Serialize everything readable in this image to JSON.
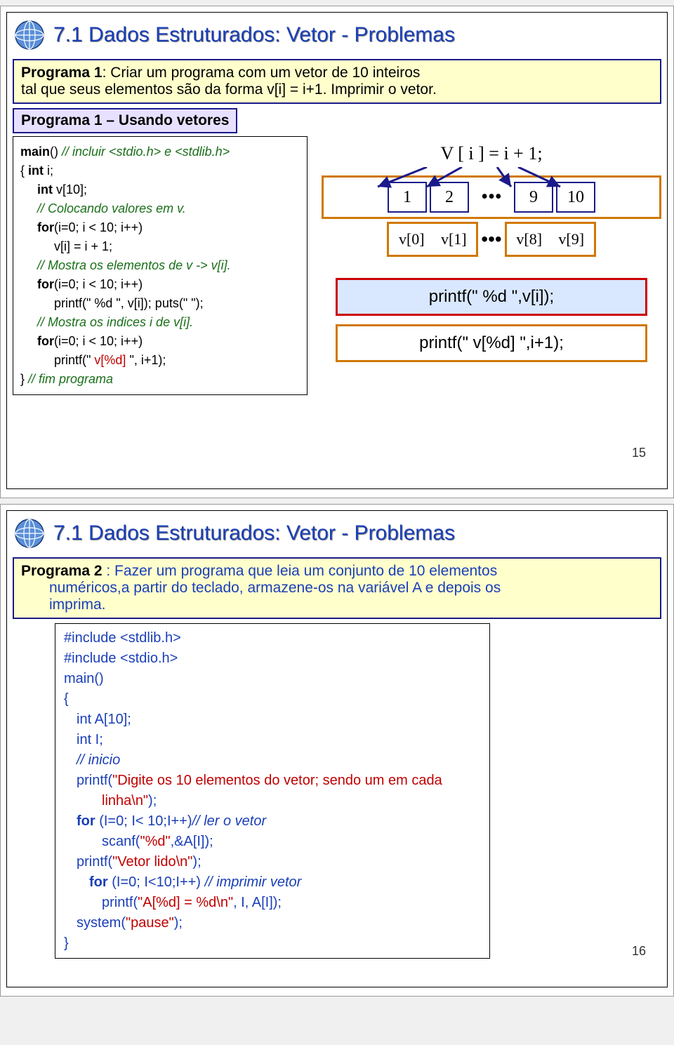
{
  "slide1": {
    "title": "7.1 Dados Estruturados: Vetor - Problemas",
    "problem": {
      "label": "Programa 1",
      "text_a": ": Criar um programa com um vetor de 10 inteiros",
      "text_b": "tal que seus elementos são da forma v[i] = i+1. Imprimir o vetor."
    },
    "purple_label": "Programa 1 – Usando vetores",
    "code": {
      "l1_a": "main",
      "l1_b": "() ",
      "l1_c": "// incluir <stdio.h> e <stdlib.h>",
      "l2_a": "{ ",
      "l2_b": "int",
      "l2_c": " i;",
      "l3_a": "int",
      "l3_b": " v[10];",
      "l4": "// Colocando valores em v.",
      "l5_a": "for",
      "l5_b": "(i=0; i < 10; i++)",
      "l6": "v[i] = i + 1;",
      "l7": "// Mostra os elementos de v -> v[i].",
      "l8_a": "for",
      "l8_b": "(i=0; i < 10; i++)",
      "l9": "printf(\" %d \", v[i]); puts(\" \");",
      "l10": "// Mostra os indices i de v[i].",
      "l11_a": "for",
      "l11_b": "(i=0; i < 10; i++)",
      "l12_a": "printf(\" ",
      "l12_b": "v[%d]",
      "l12_c": " \", i+1);",
      "l13_a": "} ",
      "l13_b": "// fim programa"
    },
    "diagram": {
      "formula": "V [ i ] = i + 1;",
      "vals": [
        "1",
        "2",
        "•••",
        "9",
        "10"
      ],
      "idx": [
        "v[0]",
        "v[1]",
        "•••",
        "v[8]",
        "v[9]"
      ],
      "printf1": "printf(\" %d \",v[i]);",
      "printf2": "printf(\" v[%d] \",i+1);"
    },
    "page": "15"
  },
  "slide2": {
    "title": "7.1 Dados Estruturados: Vetor - Problemas",
    "problem": {
      "label": "Programa 2 ",
      "text_a": ": Fazer um programa que leia um conjunto de 10 elementos",
      "text_b": "numéricos,a partir do teclado, ",
      "text_c": " armazene-os na variável A e depois os",
      "text_d": "imprima."
    },
    "code": {
      "inc1": "#include <stdlib.h>",
      "inc2": "#include <stdio.h>",
      "main": "main()",
      "ob": "{",
      "d1": "int  A[10];",
      "d2": "int  I;",
      "cm1": "// inicio",
      "p1_a": "printf(",
      "p1_b": "\"Digite os 10 elementos do vetor; sendo um em cada ",
      "p1_c": "linha\\n\"",
      "p1_d": ");",
      "for1_a": "for ",
      "for1_b": "(I=0; I< 10;I++)",
      "for1_c": "// ler o vetor",
      "sc_a": "scanf(",
      "sc_b": "\"%d\"",
      "sc_c": ",&A[I]);",
      "p2_a": "printf(",
      "p2_b": "\"Vetor lido\\n\"",
      "p2_c": ");",
      "for2_a": "for ",
      "for2_b": "(I=0; I<10;I++) ",
      "for2_c": "// imprimir vetor",
      "p3_a": "printf(",
      "p3_b": "\"A[%d] = %d\\n\"",
      "p3_c": ", I, A[I]);",
      "sys_a": "system(",
      "sys_b": "\"pause\"",
      "sys_c": ");",
      "cb": "}"
    },
    "page": "16"
  }
}
